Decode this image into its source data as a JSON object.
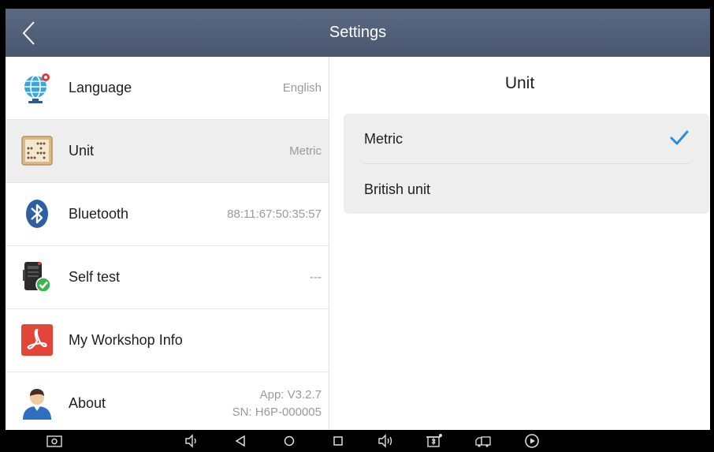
{
  "header": {
    "title": "Settings",
    "back_icon": "chevron-left-icon"
  },
  "settings_list": [
    {
      "key": "language",
      "label": "Language",
      "value": "English",
      "icon": "globe-pin-icon"
    },
    {
      "key": "unit",
      "label": "Unit",
      "value": "Metric",
      "icon": "abacus-icon",
      "selected": true
    },
    {
      "key": "bluetooth",
      "label": "Bluetooth",
      "value": "88:11:67:50:35:57",
      "icon": "bluetooth-icon"
    },
    {
      "key": "self-test",
      "label": "Self test",
      "value": "---",
      "icon": "device-check-icon"
    },
    {
      "key": "workshop",
      "label": "My Workshop Info",
      "value": "",
      "icon": "pdf-icon"
    },
    {
      "key": "about",
      "label": "About",
      "value_line1": "App: V3.2.7",
      "value_line2": "SN: H6P-000005",
      "icon": "user-avatar-icon"
    }
  ],
  "unit_panel": {
    "title": "Unit",
    "options": [
      {
        "label": "Metric",
        "checked": true
      },
      {
        "label": "British unit",
        "checked": false
      }
    ]
  },
  "navbar": {
    "icons": [
      "screenshot-icon",
      "volume-down-icon",
      "back-triangle-icon",
      "home-circle-icon",
      "recents-square-icon",
      "volume-up-icon",
      "vci-icon",
      "truck-icon",
      "play-circle-icon"
    ]
  },
  "colors": {
    "header": "#51607a",
    "selected_row": "#eeeeee",
    "accent_check": "#2b8de0"
  }
}
